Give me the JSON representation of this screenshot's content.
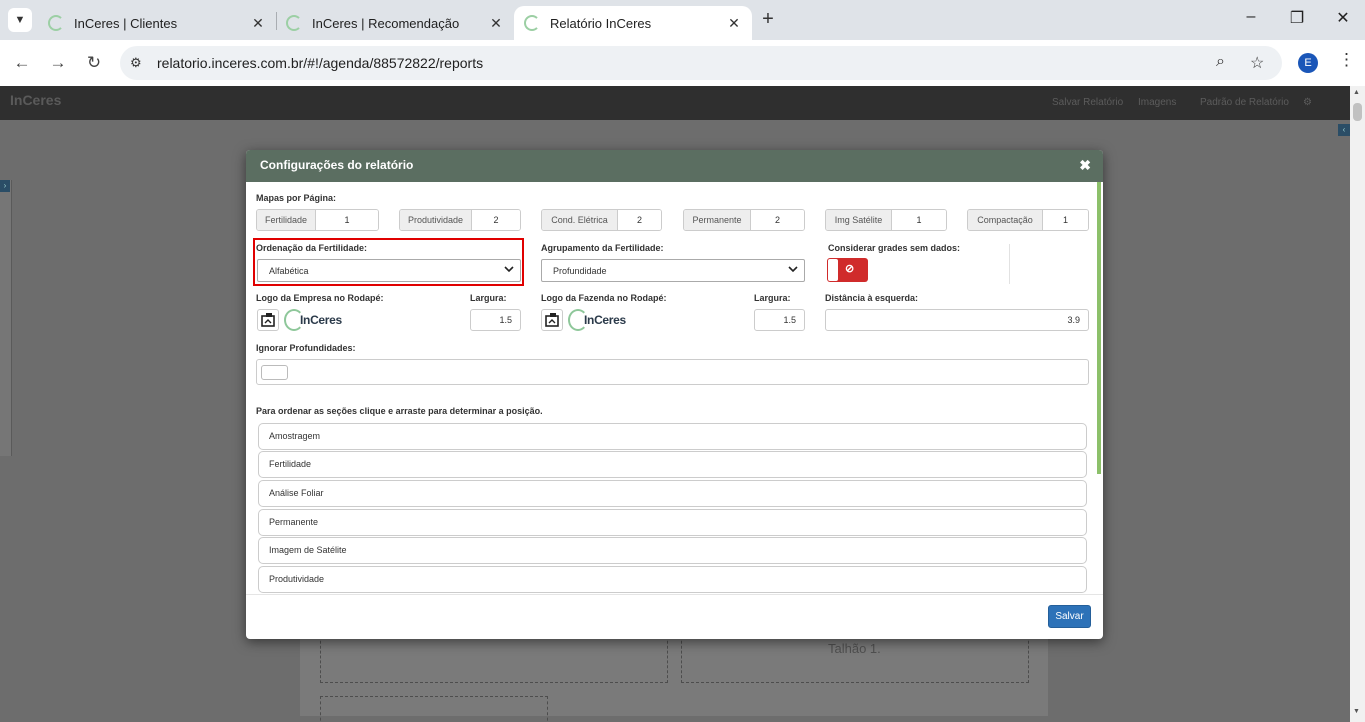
{
  "browser": {
    "tabs": [
      {
        "title": "InCeres | Clientes"
      },
      {
        "title": "InCeres | Recomendação"
      },
      {
        "title": "Relatório InCeres"
      }
    ],
    "url": "relatorio.inceres.com.br/#!/agenda/88572822/reports",
    "profile_initial": "E"
  },
  "app": {
    "logo": "InCeres",
    "nav": [
      "Salvar Relatório",
      "Imagens",
      "Padrão de Relatório"
    ],
    "background_label": "Talhão 1."
  },
  "modal": {
    "title": "Configurações do relatório",
    "maps_per_page_label": "Mapas por Página:",
    "maps_per_page": [
      {
        "label": "Fertilidade",
        "value": "1"
      },
      {
        "label": "Produtividade",
        "value": "2"
      },
      {
        "label": "Cond. Elétrica",
        "value": "2"
      },
      {
        "label": "Permanente",
        "value": "2"
      },
      {
        "label": "Img Satélite",
        "value": "1"
      },
      {
        "label": "Compactação",
        "value": "1"
      }
    ],
    "fert_order_label": "Ordenação da Fertilidade:",
    "fert_order_value": "Alfabética",
    "fert_group_label": "Agrupamento da Fertilidade:",
    "fert_group_value": "Profundidade",
    "empty_grids_label": "Considerar grades sem dados:",
    "empty_grids_enabled": false,
    "company_logo_label": "Logo da Empresa no Rodapé:",
    "company_width_label": "Largura:",
    "company_width": "1.5",
    "farm_logo_label": "Logo da Fazenda no Rodapé:",
    "farm_width_label": "Largura:",
    "farm_width": "1.5",
    "left_distance_label": "Distância à esquerda:",
    "left_distance": "3.9",
    "logo_text": "InCeres",
    "ignore_depths_label": "Ignorar Profundidades:",
    "order_hint": "Para ordenar as seções clique e arraste para determinar a posição.",
    "sections": [
      "Amostragem",
      "Fertilidade",
      "Análise Foliar",
      "Permanente",
      "Imagem de Satélite",
      "Produtividade"
    ],
    "save_label": "Salvar"
  },
  "colors": {
    "header": "#5b6e61",
    "primary_button": "#2d72b8",
    "toggle_off": "#d02b2b",
    "highlight": "#e00000"
  }
}
